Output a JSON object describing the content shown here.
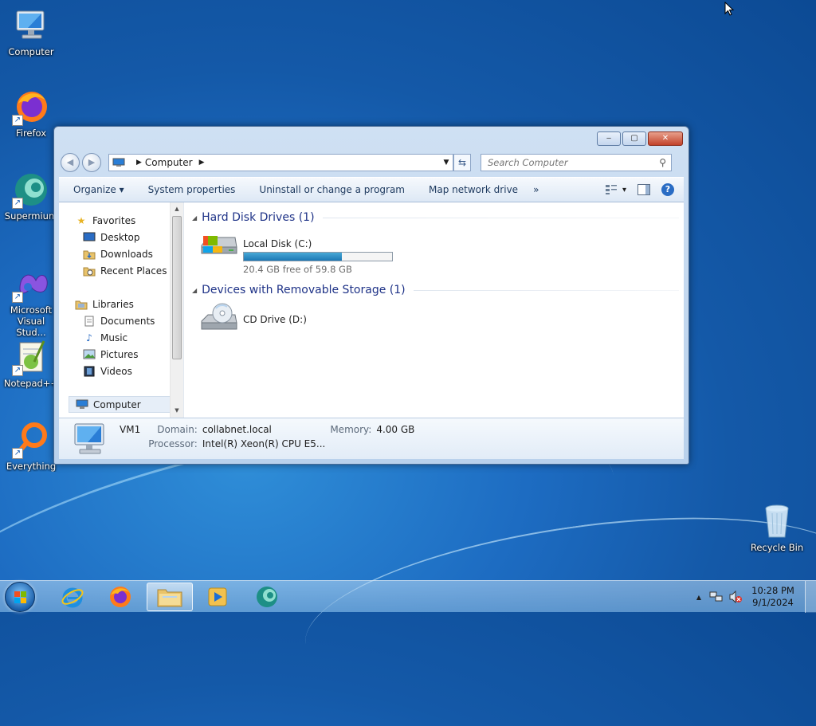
{
  "desktop": {
    "icons": [
      {
        "label": "Computer",
        "icon": "computer-icon"
      },
      {
        "label": "Firefox",
        "icon": "firefox-icon"
      },
      {
        "label": "Supermium",
        "icon": "supermium-icon"
      },
      {
        "label": "Microsoft Visual Stud...",
        "icon": "visual-studio-icon"
      },
      {
        "label": "Notepad++",
        "icon": "notepadpp-icon"
      },
      {
        "label": "Everything",
        "icon": "everything-icon"
      },
      {
        "label": "Recycle Bin",
        "icon": "recycle-bin-icon"
      }
    ]
  },
  "window": {
    "controls": {
      "minimize": "‒",
      "maximize": "▢",
      "close": "✕"
    },
    "address": {
      "segment": "Computer"
    },
    "search": {
      "placeholder": "Search Computer"
    },
    "toolbar": {
      "organize": "Organize ▾",
      "system_properties": "System properties",
      "uninstall": "Uninstall or change a program",
      "map_drive": "Map network drive",
      "more": "»",
      "views_arrow": "▾",
      "help": "?"
    },
    "nav": {
      "favorites": "Favorites",
      "desktop": "Desktop",
      "downloads": "Downloads",
      "recent_places": "Recent Places",
      "libraries": "Libraries",
      "documents": "Documents",
      "music": "Music",
      "pictures": "Pictures",
      "videos": "Videos",
      "computer": "Computer"
    },
    "groups": {
      "hard_disk": "Hard Disk Drives (1)",
      "removable": "Devices with Removable Storage (1)"
    },
    "drives": {
      "c": {
        "name": "Local Disk (C:)",
        "free_text": "20.4 GB free of 59.8 GB",
        "used_fraction": 0.659
      },
      "d": {
        "name": "CD Drive (D:)"
      }
    },
    "details": {
      "name": "VM1",
      "domain_label": "Domain:",
      "domain_value": "collabnet.local",
      "memory_label": "Memory:",
      "memory_value": "4.00 GB",
      "processor_label": "Processor:",
      "processor_value": "Intel(R) Xeon(R) CPU E5..."
    }
  },
  "taskbar": {
    "apps": [
      "internet-explorer-icon",
      "firefox-icon",
      "explorer-icon",
      "media-player-icon",
      "supermium-icon"
    ],
    "clock": {
      "time": "10:28 PM",
      "date": "9/1/2024"
    }
  }
}
